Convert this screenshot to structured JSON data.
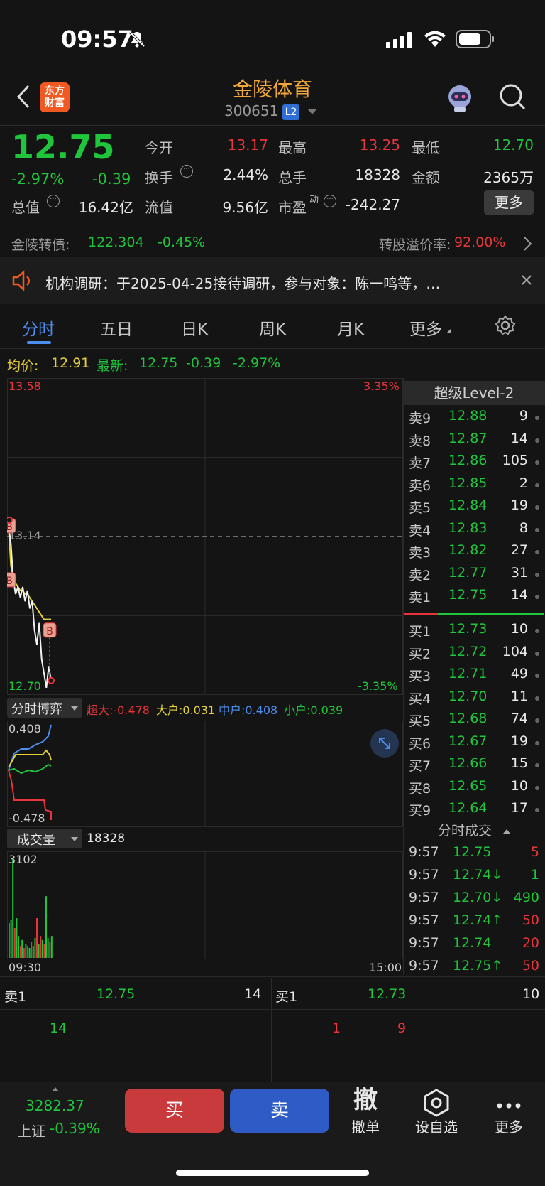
{
  "status": {
    "time": "09:57"
  },
  "header": {
    "title": "金陵体育",
    "code": "300651",
    "badge": "L2",
    "logo_line1": "东方",
    "logo_line2": "财富"
  },
  "quote": {
    "price": "12.75",
    "pct": "-2.97%",
    "chg": "-0.39",
    "open_label": "今开",
    "open": "13.17",
    "high_label": "最高",
    "high": "13.25",
    "low_label": "最低",
    "low": "12.70",
    "turnover_label": "换手",
    "turnover": "2.44%",
    "vol_label": "总手",
    "vol": "18328",
    "amount_label": "金额",
    "amount": "2365万",
    "mcap_label": "总值",
    "mcap": "16.42亿",
    "float_label": "流值",
    "float": "9.56亿",
    "pe_label": "市盈",
    "pe_sup": "动",
    "pe": "-242.27",
    "more": "更多"
  },
  "bond": {
    "label": "金陵转债:",
    "price": "122.304",
    "pct": "-0.45%",
    "premium_label": "转股溢价率:",
    "premium": "92.00%"
  },
  "notice": {
    "text": "机构调研：于2025-04-25接待调研，参与对象：陈一鸣等，…"
  },
  "tabs": [
    "分时",
    "五日",
    "日K",
    "周K",
    "月K",
    "更多"
  ],
  "chart_info": {
    "avg_label": "均价:",
    "avg": "12.91",
    "last_label": "最新:",
    "last": "12.75",
    "chg": "-0.39",
    "pct": "-2.97%"
  },
  "chart_data": {
    "type": "line",
    "y_top": "13.58",
    "y_bottom": "12.70",
    "pct_top": "3.35%",
    "pct_bottom": "-3.35%",
    "ref": "13.14",
    "x_start": "09:30",
    "x_end": "15:00",
    "ylim": [
      12.7,
      13.58
    ],
    "price": [
      13.17,
      13.12,
      13.02,
      12.98,
      13.0,
      12.97,
      13.0,
      12.96,
      12.99,
      12.94,
      12.96,
      12.88,
      12.84,
      12.9,
      12.8,
      12.76,
      12.72,
      12.78,
      12.74
    ],
    "avg": [
      13.17,
      13.06,
      13.02,
      13.01,
      13.0,
      12.99,
      12.99,
      12.98,
      12.98,
      12.97,
      12.96,
      12.95,
      12.94,
      12.93,
      12.92,
      12.91,
      12.91,
      12.91,
      12.91
    ],
    "markers": [
      {
        "label": "B",
        "y": 13.17
      },
      {
        "label": "B",
        "y": 13.02
      },
      {
        "label": "B",
        "y": 12.88
      }
    ]
  },
  "flow": {
    "title": "分时博弈",
    "super_label": "超大:",
    "super": "-0.478",
    "big_label": "大户:",
    "big": "0.031",
    "mid_label": "中户:",
    "mid": "0.408",
    "small_label": "小户:",
    "small": "0.039",
    "y_top": "0.408",
    "y_bottom": "-0.478"
  },
  "volume": {
    "title": "成交量",
    "total": "18328",
    "y_top": "3102",
    "bars": [
      0.35,
      0.38,
      1.0,
      0.3,
      0.4,
      0.22,
      0.12,
      0.18,
      0.1,
      0.14,
      0.12,
      0.1,
      0.16,
      0.12,
      0.2,
      0.4,
      0.14,
      0.22,
      0.18,
      0.14,
      0.62,
      0.2,
      0.16,
      0.22
    ],
    "bar_colors": [
      "r",
      "g",
      "g",
      "r",
      "g",
      "g",
      "r",
      "g",
      "r",
      "g",
      "r",
      "g",
      "r",
      "g",
      "g",
      "r",
      "g",
      "r",
      "g",
      "r",
      "g",
      "g",
      "r",
      "g"
    ]
  },
  "orderbook": {
    "title": "超级Level-2",
    "asks": [
      {
        "label": "卖9",
        "price": "12.88",
        "vol": "9"
      },
      {
        "label": "卖8",
        "price": "12.87",
        "vol": "14"
      },
      {
        "label": "卖7",
        "price": "12.86",
        "vol": "105"
      },
      {
        "label": "卖6",
        "price": "12.85",
        "vol": "2"
      },
      {
        "label": "卖5",
        "price": "12.84",
        "vol": "19"
      },
      {
        "label": "卖4",
        "price": "12.83",
        "vol": "8"
      },
      {
        "label": "卖3",
        "price": "12.82",
        "vol": "27"
      },
      {
        "label": "卖2",
        "price": "12.77",
        "vol": "31"
      },
      {
        "label": "卖1",
        "price": "12.75",
        "vol": "14"
      }
    ],
    "bids": [
      {
        "label": "买1",
        "price": "12.73",
        "vol": "10"
      },
      {
        "label": "买2",
        "price": "12.72",
        "vol": "104"
      },
      {
        "label": "买3",
        "price": "12.71",
        "vol": "49"
      },
      {
        "label": "买4",
        "price": "12.70",
        "vol": "11"
      },
      {
        "label": "买5",
        "price": "12.68",
        "vol": "74"
      },
      {
        "label": "买6",
        "price": "12.67",
        "vol": "19"
      },
      {
        "label": "买7",
        "price": "12.66",
        "vol": "15"
      },
      {
        "label": "买8",
        "price": "12.65",
        "vol": "10"
      },
      {
        "label": "买9",
        "price": "12.64",
        "vol": "17"
      }
    ]
  },
  "trades": {
    "title": "分时成交",
    "rows": [
      {
        "time": "9:57",
        "price": "12.75",
        "arrow": "",
        "vol": "5",
        "pcolor": "green",
        "vcolor": "red"
      },
      {
        "time": "9:57",
        "price": "12.74↓",
        "arrow": "",
        "vol": "1",
        "pcolor": "green",
        "vcolor": "green"
      },
      {
        "time": "9:57",
        "price": "12.70↓",
        "arrow": "",
        "vol": "490",
        "pcolor": "green",
        "vcolor": "green"
      },
      {
        "time": "9:57",
        "price": "12.74↑",
        "arrow": "",
        "vol": "50",
        "pcolor": "green",
        "vcolor": "red"
      },
      {
        "time": "9:57",
        "price": "12.74",
        "arrow": "",
        "vol": "20",
        "pcolor": "green",
        "vcolor": "red"
      },
      {
        "time": "9:57",
        "price": "12.75↑",
        "arrow": "",
        "vol": "50",
        "pcolor": "green",
        "vcolor": "red"
      }
    ]
  },
  "queue": {
    "ask_label": "卖1",
    "ask_price": "12.75",
    "ask_vol": "14",
    "ask_queue": [
      "14"
    ],
    "bid_label": "买1",
    "bid_price": "12.73",
    "bid_vol": "10",
    "bid_queue": [
      "1",
      "9"
    ]
  },
  "bottom": {
    "index_value": "3282.37",
    "index_name": "上证",
    "index_pct": "-0.39%",
    "buy": "买",
    "sell": "卖",
    "cancel_icon": "撤",
    "cancel": "撤单",
    "watch": "设自选",
    "more": "更多"
  }
}
